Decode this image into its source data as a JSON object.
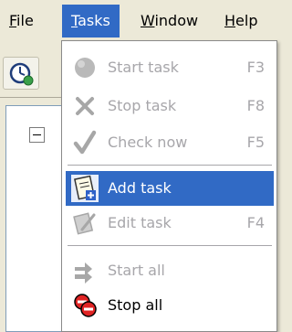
{
  "menubar": {
    "items": [
      {
        "label": "File",
        "mnemonic": "F",
        "rest": "ile"
      },
      {
        "label": "Tasks",
        "mnemonic": "T",
        "rest": "asks"
      },
      {
        "label": "Window",
        "mnemonic": "W",
        "rest": "indow"
      },
      {
        "label": "Help",
        "mnemonic": "H",
        "rest": "elp"
      }
    ],
    "active": "Tasks",
    "active_color": "#316ac5"
  },
  "toolbar": {
    "buttons": [
      {
        "icon": "clock-icon"
      }
    ]
  },
  "tasks_menu": {
    "items": [
      {
        "label": "Start task",
        "shortcut": "F3",
        "icon": "start-task-icon",
        "enabled": false
      },
      {
        "label": "Stop task",
        "shortcut": "F8",
        "icon": "stop-task-icon",
        "enabled": false
      },
      {
        "label": "Check now",
        "shortcut": "F5",
        "icon": "check-now-icon",
        "enabled": false
      },
      {
        "label": "Add task",
        "shortcut": "",
        "icon": "add-task-icon",
        "enabled": true,
        "highlighted": true
      },
      {
        "label": "Edit task",
        "shortcut": "F4",
        "icon": "edit-task-icon",
        "enabled": false
      },
      {
        "label": "Start all",
        "shortcut": "",
        "icon": "start-all-icon",
        "enabled": false
      },
      {
        "label": "Stop all",
        "shortcut": "",
        "icon": "stop-all-icon",
        "enabled": true
      }
    ],
    "disabled_color": "#a7a6aa",
    "highlight_color": "#316ac5"
  }
}
